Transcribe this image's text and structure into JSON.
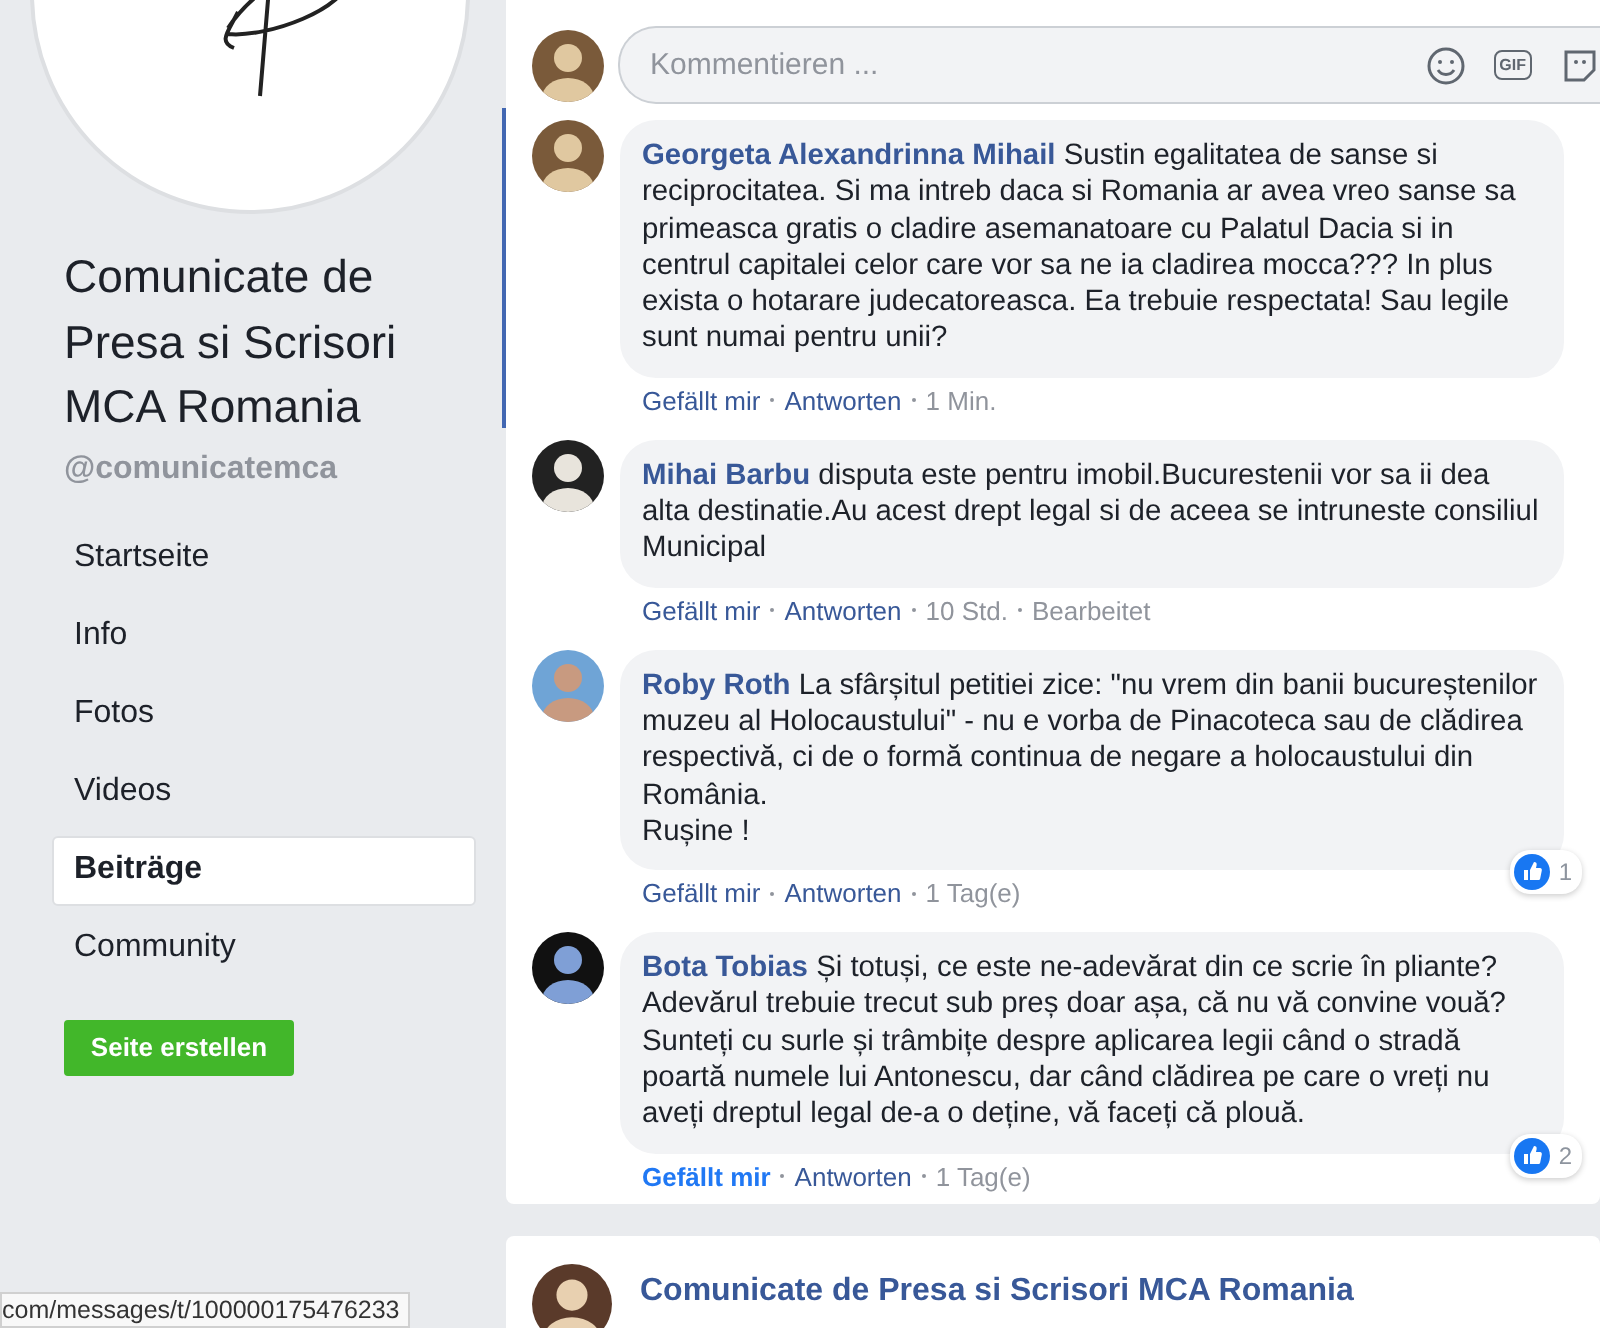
{
  "page": {
    "title": "Comunicate de Presa si Scrisori MCA Romania",
    "handle": "@comunicatemca"
  },
  "nav": [
    {
      "label": "Startseite",
      "selected": false
    },
    {
      "label": "Info",
      "selected": false
    },
    {
      "label": "Fotos",
      "selected": false
    },
    {
      "label": "Videos",
      "selected": false
    },
    {
      "label": "Beiträge",
      "selected": true
    },
    {
      "label": "Community",
      "selected": false
    }
  ],
  "create_button": "Seite erstellen",
  "composer": {
    "placeholder": "Kommentieren ...",
    "gif_label": "GIF"
  },
  "comments": [
    {
      "author": "Georgeta Alexandrinna Mihail",
      "text": "Sustin egalitatea de sanse si reciprocitatea. Si ma intreb daca si Romania ar avea vreo sanse sa primeasca gratis o cladire asemanatoare cu Palatul Dacia si in centrul capitalei celor care vor sa ne ia cladirea mocca??? In plus exista o hotarare judecatoreasca. Ea trebuie respectata! Sau legile sunt numai pentru unii?",
      "highlighted": true,
      "liked": false,
      "meta": [
        {
          "kind": "link",
          "text": "Gefällt mir"
        },
        {
          "kind": "link",
          "text": "Antworten"
        },
        {
          "kind": "time",
          "text": "1 Min."
        }
      ]
    },
    {
      "author": "Mihai Barbu",
      "text": "disputa este pentru imobil.Bucurestenii vor sa ii dea alta destinatie.Au acest drept legal si de aceea se intruneste consiliul Municipal",
      "highlighted": false,
      "liked": false,
      "meta": [
        {
          "kind": "link",
          "text": "Gefällt mir"
        },
        {
          "kind": "link",
          "text": "Antworten"
        },
        {
          "kind": "time",
          "text": "10 Std."
        },
        {
          "kind": "time",
          "text": "Bearbeitet"
        }
      ]
    },
    {
      "author": "Roby Roth",
      "text": "La sfârșitul petitiei zice: \"nu vrem din banii bucureștenilor muzeu al Holocaustului\" - nu e vorba de Pinacoteca sau de clădirea respectivă, ci de o formă continua de negare a holocaustului din România.\nRușine !",
      "highlighted": false,
      "liked": false,
      "reaction_count": "1",
      "meta": [
        {
          "kind": "link",
          "text": "Gefällt mir"
        },
        {
          "kind": "link",
          "text": "Antworten"
        },
        {
          "kind": "time",
          "text": "1 Tag(e)"
        }
      ]
    },
    {
      "author": "Bota Tobias",
      "text": "Și totuși, ce este ne-adevărat din ce scrie în pliante? Adevărul trebuie trecut sub preș doar așa, că nu vă convine vouă? Sunteți cu surle și trâmbițe despre aplicarea legii când o stradă poartă numele lui Antonescu, dar când clădirea pe care o vreți nu aveți dreptul legal de-a o deține, vă faceți că plouă.",
      "highlighted": false,
      "liked": true,
      "reaction_count": "2",
      "meta": [
        {
          "kind": "link",
          "text": "Gefällt mir"
        },
        {
          "kind": "link",
          "text": "Antworten"
        },
        {
          "kind": "time",
          "text": "1 Tag(e)"
        }
      ]
    }
  ],
  "next_post": {
    "title": "Comunicate de Presa si Scrisori MCA Romania"
  },
  "status_url": "com/messages/t/100000175476233"
}
